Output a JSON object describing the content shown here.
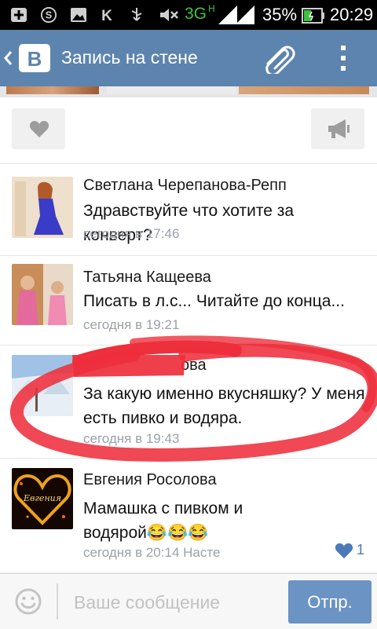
{
  "status_bar": {
    "network": "3G",
    "network_sub": "H",
    "battery": "35%",
    "time": "20:29"
  },
  "header": {
    "title": "Запись на стене"
  },
  "comments": [
    {
      "name": "Светлана Черепанова-Репп",
      "text_lines": [
        "Здравствуйте что хотите за конверт?"
      ],
      "time": "сегодня в 17:46"
    },
    {
      "name": "Татьяна Кащеева",
      "text_lines": [
        "Писать в л.с... Читайте до конца..."
      ],
      "time": "сегодня в 19:21"
    },
    {
      "name": "",
      "name_tail": "ова",
      "text_lines": [
        "За какую именно вкусняшку? У меня",
        "есть пивко и водяра."
      ],
      "time": "сегодня в 19:43"
    },
    {
      "name": "Евгения Росолова",
      "text_lines": [
        "Мамашка с пивком и",
        "водярой😂😂😂"
      ],
      "time": "сегодня в 20:14 Насте",
      "likes": "1",
      "avatar_caption": "Евгения"
    }
  ],
  "composer": {
    "placeholder": "Ваше сообщение",
    "send_label": "Отпр."
  },
  "colors": {
    "appbar": "#5d84ae",
    "send": "#6b93c4",
    "like_heart": "#4a7ab9",
    "scribble": "#ee2f3c"
  }
}
